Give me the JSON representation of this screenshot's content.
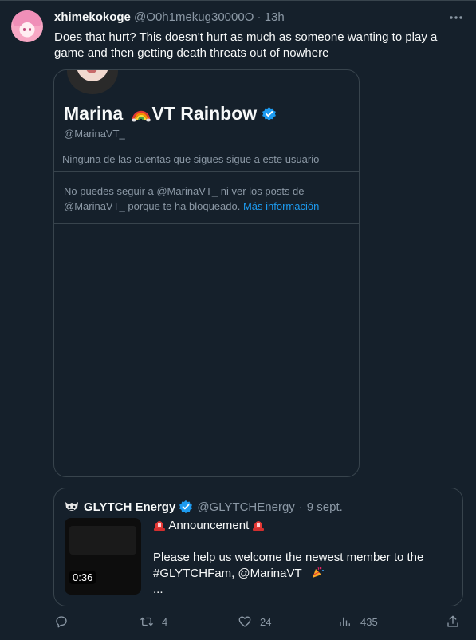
{
  "tweet": {
    "author_name": "xhimekokoge",
    "author_handle": "@O0h1mekug30000O",
    "separator": "·",
    "time": "13h",
    "more_icon": "ellipsis-icon",
    "text": "Does that hurt? This doesn't hurt as much as someone wanting to play a game and then getting death threats out of nowhere"
  },
  "card": {
    "display_name_prefix": "Marina ",
    "display_name_suffix": "VT Rainbow",
    "handle": "@MarinaVT_",
    "follow_note": "Ninguna de las cuentas que sigues sigue a este usuario",
    "blocked_text": "No puedes seguir a @MarinaVT_ ni ver los posts de @MarinaVT_ porque te ha bloqueado.",
    "blocked_link": "Más información"
  },
  "quote": {
    "name": "GLYTCH Energy",
    "handle": "@GLYTCHEnergy",
    "separator": "·",
    "date": "9 sept.",
    "video_duration": "0:36",
    "headline": "Announcement",
    "body": "Please help us welcome the newest member to the #GLYTCHFam, @MarinaVT_",
    "ellipsis": "..."
  },
  "actions": {
    "reply_icon": "reply-icon",
    "retweet_icon": "retweet-icon",
    "retweets": "4",
    "like_icon": "heart-icon",
    "likes": "24",
    "views_icon": "views-icon",
    "views": "435",
    "share_icon": "share-icon"
  },
  "colors": {
    "background": "#15202b",
    "border": "#38444d",
    "muted": "#8b98a5",
    "link": "#1d9bf0",
    "verified": "#1d9bf0"
  }
}
